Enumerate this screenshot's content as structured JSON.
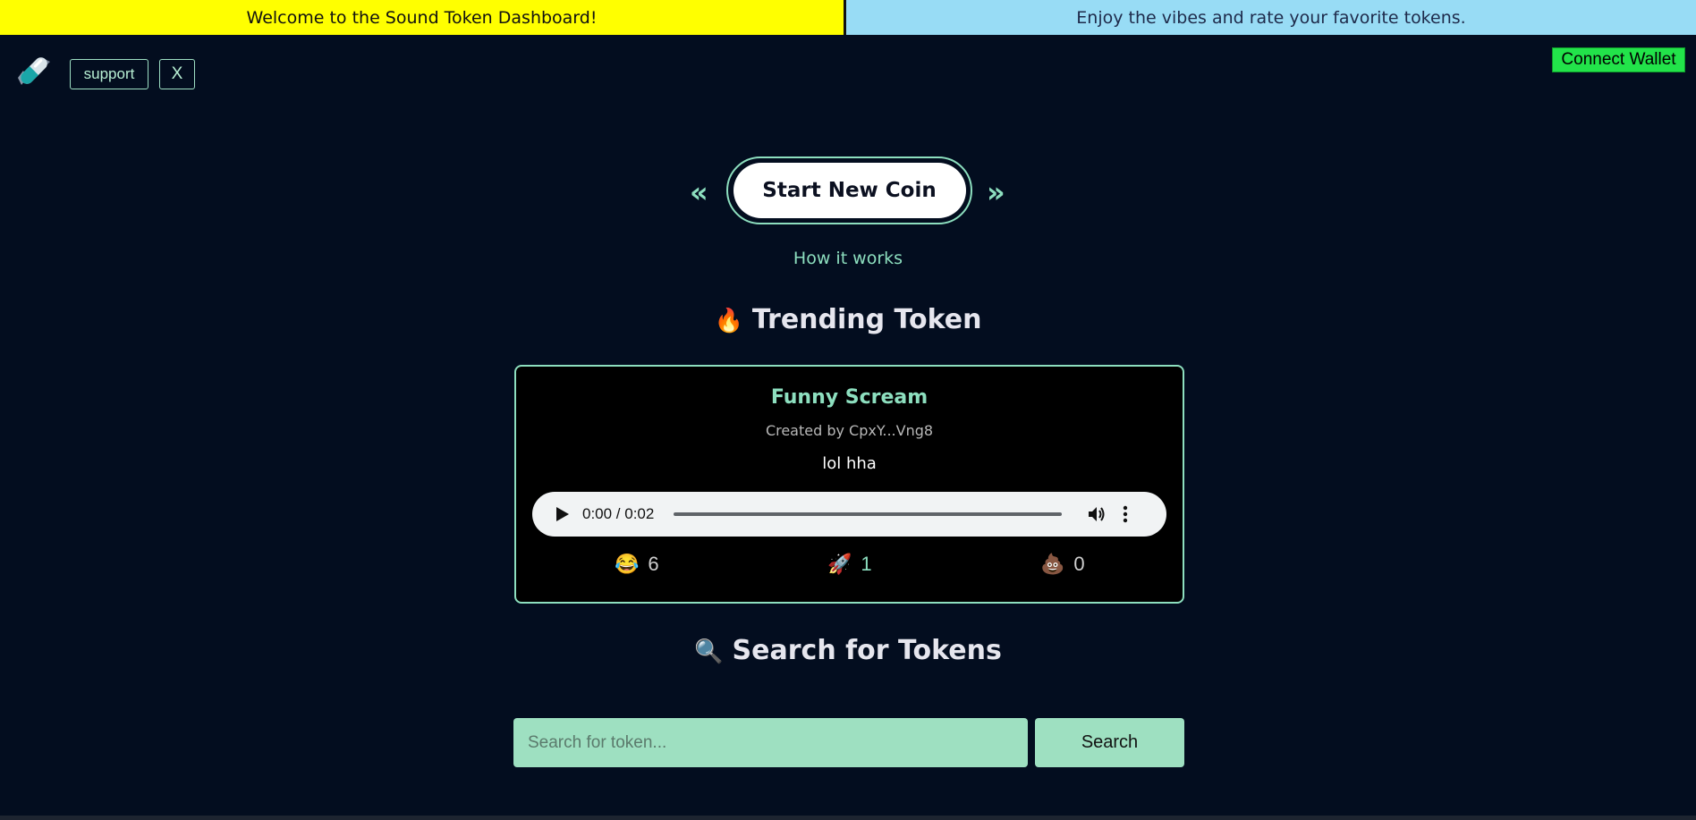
{
  "banner": {
    "left_text": "Welcome to the Sound Token Dashboard!",
    "right_text": "Enjoy the vibes and rate your favorite tokens."
  },
  "header": {
    "logo_icon": "pill-capsule-icon",
    "support_label": "support",
    "x_label": "X",
    "wallet_label": "Connect Wallet"
  },
  "hero": {
    "prev_arrow": "«",
    "next_arrow": "»",
    "start_label": "Start New Coin",
    "how_label": "How it works"
  },
  "trending": {
    "icon": "🔥",
    "title": "Trending Token",
    "token": {
      "name": "Funny Scream",
      "creator": "Created by CpxY...Vng8",
      "description": "lol hha",
      "audio_time": "0:00 / 0:02",
      "reactions": [
        {
          "emoji": "😂",
          "count": "6"
        },
        {
          "emoji": "🚀",
          "count": "1"
        },
        {
          "emoji": "💩",
          "count": "0"
        }
      ]
    }
  },
  "search": {
    "icon": "🔍",
    "title": "Search for Tokens",
    "placeholder": "Search for token...",
    "value": "",
    "button_label": "Search"
  },
  "colors": {
    "background": "#030d1f",
    "accent": "#8ddfbf",
    "banner_yellow": "#ffff00",
    "banner_blue": "#98dcf5",
    "wallet_green": "#22e34a"
  }
}
